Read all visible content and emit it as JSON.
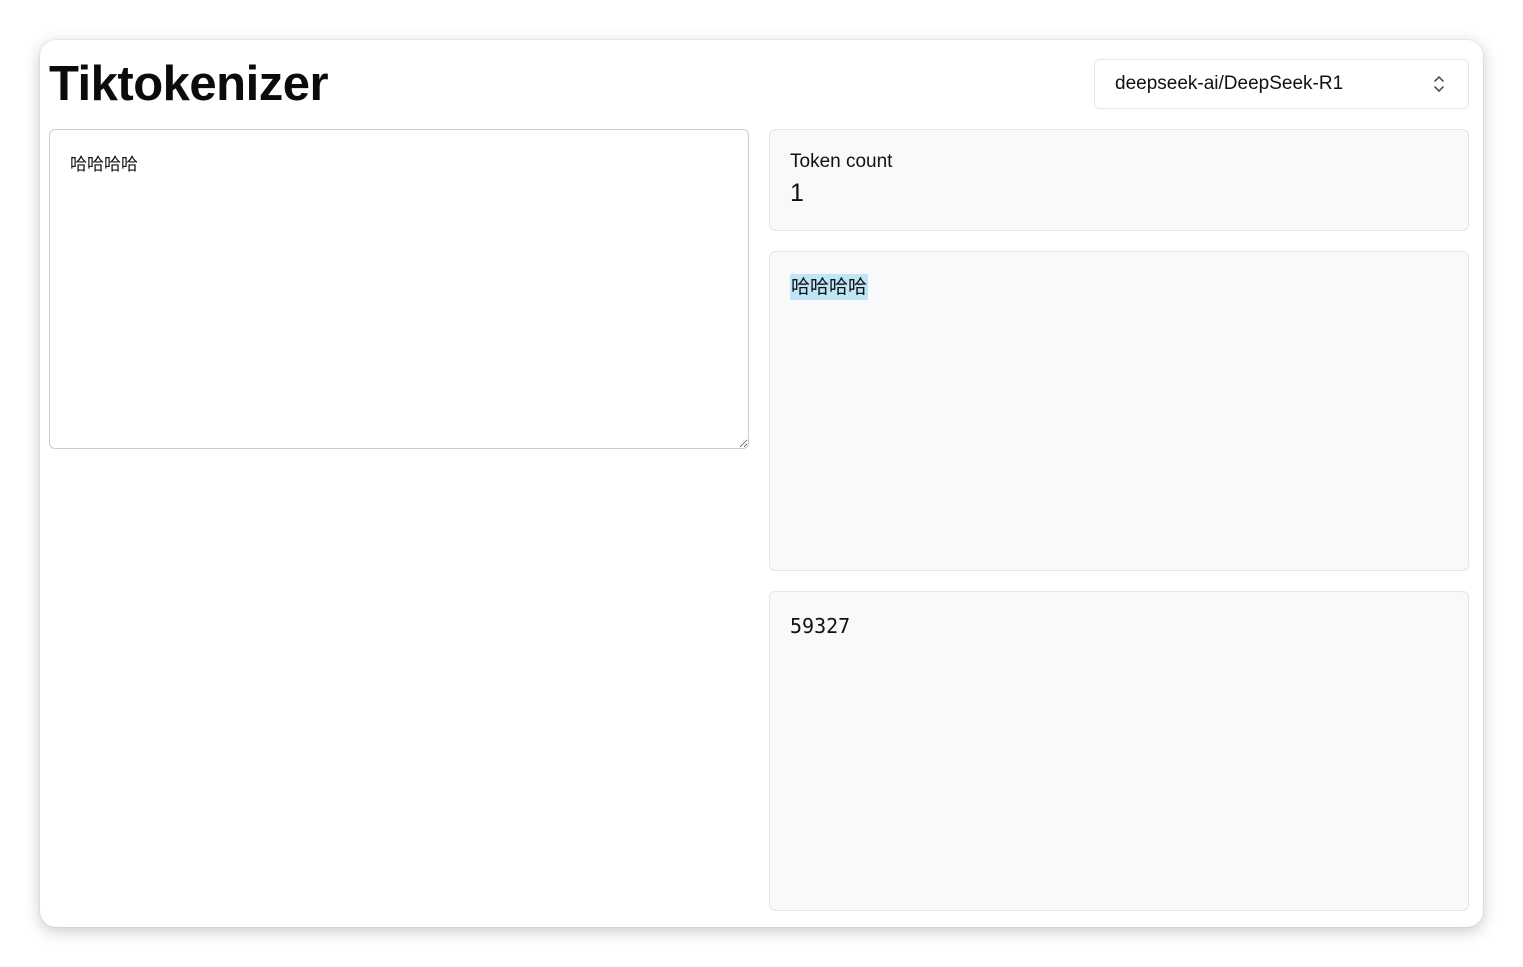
{
  "app": {
    "title": "Tiktokenizer"
  },
  "model_select": {
    "selected": "deepseek-ai/DeepSeek-R1"
  },
  "input": {
    "value": "哈哈哈哈"
  },
  "token_count": {
    "label": "Token count",
    "value": "1"
  },
  "tokens": [
    {
      "text": "哈哈哈哈",
      "highlight_color": "#bfe6f7"
    }
  ],
  "token_ids": {
    "text": "59327"
  },
  "icons": {
    "select_chevron": "chevron-up-down-icon"
  }
}
